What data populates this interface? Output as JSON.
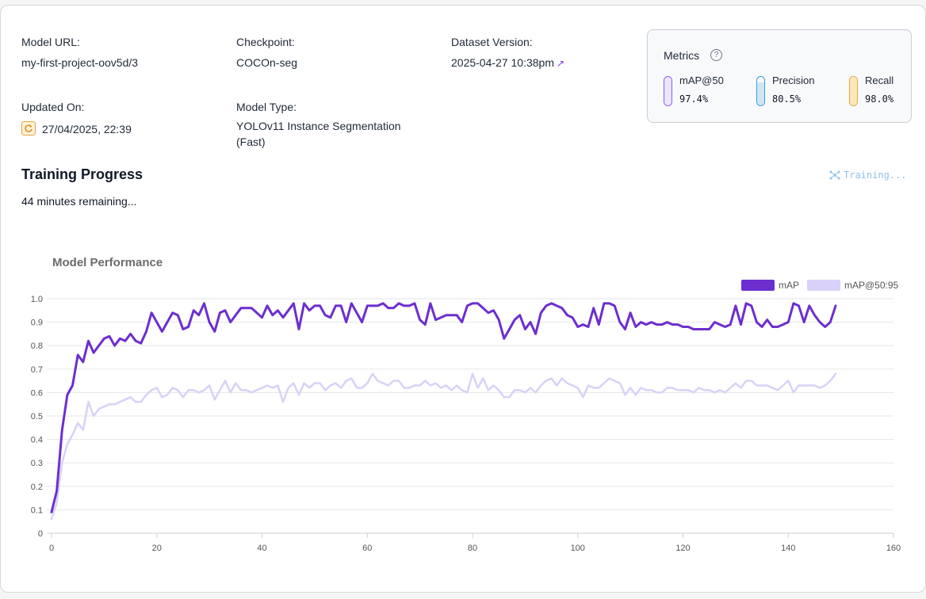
{
  "model_url": {
    "label": "Model URL:",
    "value": "my-first-project-oov5d/3"
  },
  "checkpoint": {
    "label": "Checkpoint:",
    "value": "COCOn-seg"
  },
  "dataset_version": {
    "label": "Dataset Version:",
    "value": "2025-04-27 10:38pm",
    "arrow": "↗"
  },
  "updated_on": {
    "label": "Updated On:",
    "value": "27/04/2025, 22:39",
    "icon": "refresh-icon"
  },
  "model_type": {
    "label": "Model Type:",
    "value": "YOLOv11 Instance Segmentation (Fast)"
  },
  "metrics": {
    "title": "Metrics",
    "help_symbol": "?",
    "items": [
      {
        "name": "mAP@50",
        "value": "97.4%",
        "fraction": 0.974,
        "color": "#8b5cf6",
        "fill": "#ede4fe"
      },
      {
        "name": "Precision",
        "value": "80.5%",
        "fraction": 0.805,
        "color": "#3b9bd4",
        "fill": "#cfe6f5"
      },
      {
        "name": "Recall",
        "value": "98.0%",
        "fraction": 0.98,
        "color": "#e0a640",
        "fill": "#fde7b8"
      }
    ]
  },
  "training_progress": {
    "title": "Training Progress",
    "remaining": "44 minutes remaining...",
    "status": "Training..."
  },
  "chart_data": {
    "type": "line",
    "title": "Model Performance",
    "xlim": [
      0,
      160
    ],
    "ylim": [
      0,
      1.0
    ],
    "x_ticks": [
      0,
      20,
      40,
      60,
      80,
      100,
      120,
      140,
      160
    ],
    "y_ticks": [
      "0",
      "0.1",
      "0.2",
      "0.3",
      "0.4",
      "0.5",
      "0.6",
      "0.7",
      "0.8",
      "0.9",
      "1.0"
    ],
    "grid": true,
    "legend_position": "top-right",
    "series": [
      {
        "name": "mAP",
        "color": "#6d2ecf",
        "values": [
          0.09,
          0.18,
          0.44,
          0.59,
          0.63,
          0.76,
          0.73,
          0.82,
          0.77,
          0.8,
          0.83,
          0.84,
          0.8,
          0.83,
          0.82,
          0.85,
          0.82,
          0.81,
          0.86,
          0.94,
          0.9,
          0.86,
          0.9,
          0.94,
          0.93,
          0.87,
          0.88,
          0.95,
          0.93,
          0.98,
          0.9,
          0.86,
          0.94,
          0.95,
          0.9,
          0.93,
          0.96,
          0.96,
          0.96,
          0.94,
          0.92,
          0.97,
          0.93,
          0.95,
          0.92,
          0.95,
          0.98,
          0.87,
          0.98,
          0.95,
          0.97,
          0.97,
          0.93,
          0.92,
          0.97,
          0.97,
          0.9,
          0.98,
          0.94,
          0.9,
          0.97,
          0.97,
          0.97,
          0.98,
          0.96,
          0.96,
          0.98,
          0.97,
          0.97,
          0.98,
          0.91,
          0.89,
          0.98,
          0.91,
          0.92,
          0.93,
          0.93,
          0.93,
          0.9,
          0.97,
          0.98,
          0.98,
          0.96,
          0.94,
          0.95,
          0.91,
          0.83,
          0.87,
          0.91,
          0.93,
          0.87,
          0.9,
          0.85,
          0.94,
          0.97,
          0.98,
          0.97,
          0.96,
          0.93,
          0.92,
          0.88,
          0.89,
          0.88,
          0.96,
          0.89,
          0.98,
          0.98,
          0.97,
          0.9,
          0.87,
          0.94,
          0.88,
          0.9,
          0.89,
          0.9,
          0.89,
          0.89,
          0.9,
          0.89,
          0.89,
          0.88,
          0.88,
          0.87,
          0.87,
          0.87,
          0.87,
          0.9,
          0.89,
          0.88,
          0.89,
          0.97,
          0.89,
          0.98,
          0.97,
          0.9,
          0.88,
          0.91,
          0.88,
          0.88,
          0.89,
          0.9,
          0.98,
          0.97,
          0.9,
          0.97,
          0.93,
          0.9,
          0.88,
          0.9,
          0.97
        ]
      },
      {
        "name": "mAP@50:95",
        "color": "#d9d1f7",
        "values": [
          0.06,
          0.13,
          0.3,
          0.38,
          0.42,
          0.47,
          0.44,
          0.56,
          0.5,
          0.53,
          0.54,
          0.55,
          0.55,
          0.56,
          0.57,
          0.58,
          0.56,
          0.56,
          0.59,
          0.61,
          0.62,
          0.58,
          0.59,
          0.62,
          0.61,
          0.58,
          0.61,
          0.61,
          0.6,
          0.61,
          0.63,
          0.57,
          0.61,
          0.65,
          0.6,
          0.64,
          0.61,
          0.61,
          0.6,
          0.61,
          0.62,
          0.63,
          0.62,
          0.63,
          0.56,
          0.62,
          0.64,
          0.59,
          0.64,
          0.62,
          0.64,
          0.64,
          0.61,
          0.63,
          0.64,
          0.62,
          0.65,
          0.66,
          0.62,
          0.62,
          0.64,
          0.68,
          0.65,
          0.64,
          0.63,
          0.65,
          0.65,
          0.62,
          0.62,
          0.63,
          0.63,
          0.65,
          0.63,
          0.64,
          0.62,
          0.63,
          0.61,
          0.63,
          0.61,
          0.6,
          0.68,
          0.62,
          0.66,
          0.61,
          0.63,
          0.61,
          0.58,
          0.58,
          0.61,
          0.61,
          0.6,
          0.62,
          0.6,
          0.63,
          0.65,
          0.66,
          0.63,
          0.66,
          0.64,
          0.63,
          0.62,
          0.58,
          0.63,
          0.62,
          0.62,
          0.64,
          0.66,
          0.65,
          0.64,
          0.59,
          0.62,
          0.59,
          0.62,
          0.61,
          0.61,
          0.6,
          0.6,
          0.62,
          0.62,
          0.61,
          0.61,
          0.61,
          0.6,
          0.62,
          0.61,
          0.61,
          0.6,
          0.61,
          0.6,
          0.62,
          0.64,
          0.62,
          0.65,
          0.65,
          0.63,
          0.63,
          0.63,
          0.62,
          0.61,
          0.63,
          0.65,
          0.6,
          0.63,
          0.63,
          0.63,
          0.63,
          0.62,
          0.63,
          0.65,
          0.68
        ]
      }
    ]
  }
}
